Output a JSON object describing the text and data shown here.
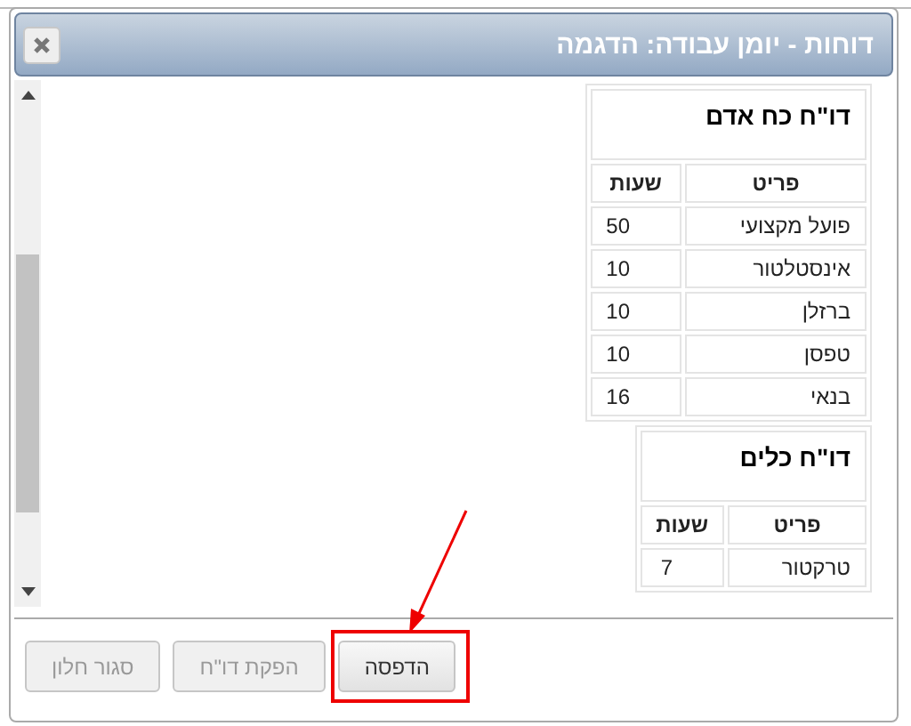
{
  "window": {
    "title": "דוחות - יומן עבודה: הדגמה"
  },
  "reports": [
    {
      "title": "דו\"ח כח אדם",
      "columns": [
        "פריט",
        "שעות"
      ],
      "rows": [
        [
          "פועל מקצועי",
          "50"
        ],
        [
          "אינסטלטור",
          "10"
        ],
        [
          "ברזלן",
          "10"
        ],
        [
          "טפסן",
          "10"
        ],
        [
          "בנאי",
          "16"
        ]
      ]
    },
    {
      "title": "דו\"ח כלים",
      "columns": [
        "פריט",
        "שעות"
      ],
      "rows": [
        [
          "טרקטור",
          "7"
        ]
      ]
    }
  ],
  "buttons": [
    {
      "label": "הדפסה",
      "disabled": false,
      "highlighted": true
    },
    {
      "label": "הפקת דו\"ח",
      "disabled": true,
      "highlighted": false
    },
    {
      "label": "סגור חלון",
      "disabled": true,
      "highlighted": false
    }
  ]
}
